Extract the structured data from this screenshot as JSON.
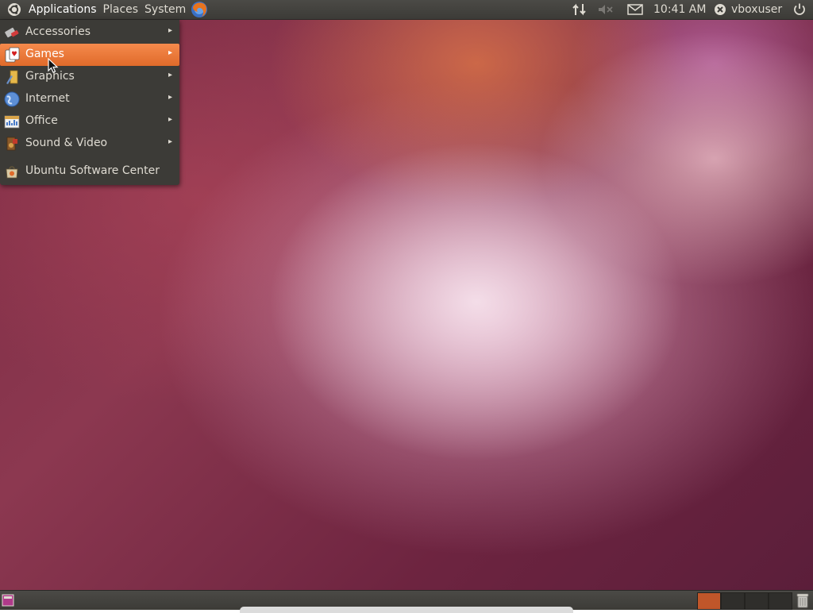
{
  "top_panel": {
    "menus": [
      "Applications",
      "Places",
      "System"
    ],
    "clock": "10:41 AM",
    "username": "vboxuser"
  },
  "applications_menu": {
    "items": [
      {
        "label": "Accessories",
        "icon": "accessories-icon",
        "submenu": true
      },
      {
        "label": "Games",
        "icon": "games-icon",
        "submenu": true,
        "highlighted": true
      },
      {
        "label": "Graphics",
        "icon": "graphics-icon",
        "submenu": true
      },
      {
        "label": "Internet",
        "icon": "internet-icon",
        "submenu": true
      },
      {
        "label": "Office",
        "icon": "office-icon",
        "submenu": true
      },
      {
        "label": "Sound & Video",
        "icon": "sound-video-icon",
        "submenu": true
      },
      {
        "label": "Ubuntu Software Center",
        "icon": "software-center-icon",
        "submenu": false
      }
    ]
  },
  "colors": {
    "panel": "#3c3b37",
    "highlight": "#e86f2e",
    "active_workspace": "#c0562a"
  }
}
